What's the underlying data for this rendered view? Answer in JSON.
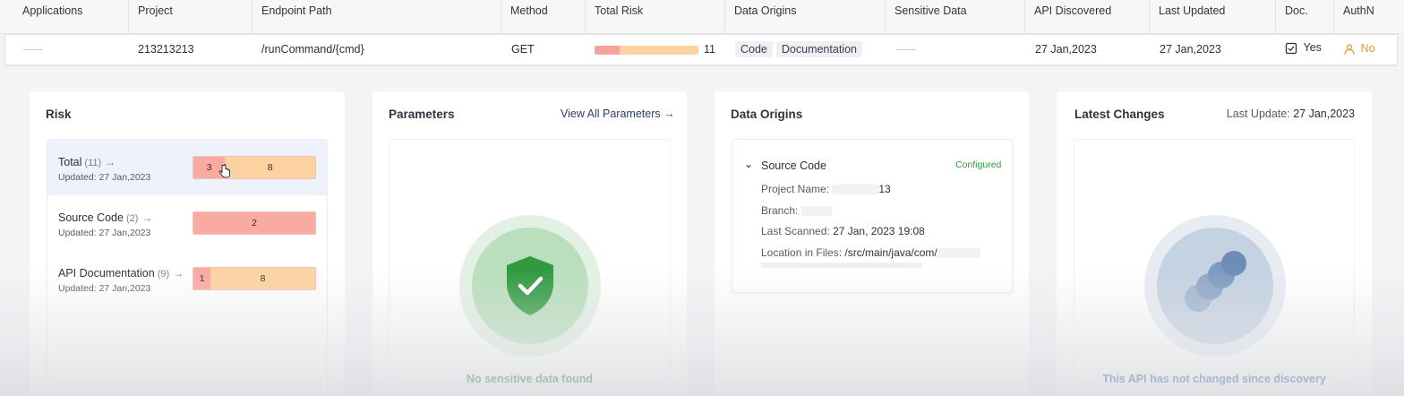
{
  "table": {
    "headers": [
      "Applications",
      "Project",
      "Endpoint Path",
      "Method",
      "Total Risk",
      "Data Origins",
      "Sensitive Data",
      "API Discovered",
      "Last Updated",
      "Doc.",
      "AuthN"
    ],
    "row": {
      "project": "213213213",
      "endpoint": "/runCommand/{cmd}",
      "method": "GET",
      "risk_total": "11",
      "risk_fraction_red": 0.24,
      "origins": [
        "Code",
        "Documentation"
      ],
      "discovered": "27 Jan,2023",
      "updated": "27 Jan,2023",
      "doc": "Yes",
      "authn": "No"
    }
  },
  "risk": {
    "title": "Risk",
    "items": [
      {
        "label": "Total",
        "count": "(11)",
        "updated": "Updated: 27 Jan,2023",
        "red": "3",
        "orange": "8"
      },
      {
        "label": "Source Code",
        "count": "(2)",
        "updated": "Updated: 27 Jan,2023",
        "red": "2",
        "orange": ""
      },
      {
        "label": "API Documentation",
        "count": "(9)",
        "updated": "Updated: 27 Jan,2023",
        "red": "1",
        "orange": "8"
      }
    ]
  },
  "parameters": {
    "title": "Parameters",
    "view_all": "View All Parameters →",
    "empty": "No sensitive data found"
  },
  "data_origins": {
    "title": "Data Origins",
    "source": "Source Code",
    "status": "Configured",
    "project_label": "Project Name:",
    "project_suffix": "13",
    "branch_label": "Branch:",
    "scanned_label": "Last Scanned:",
    "scanned_value": "27 Jan, 2023 19:08",
    "location_label": "Location in Files:",
    "location_value": "/src/main/java/com/"
  },
  "latest": {
    "title": "Latest Changes",
    "last_update_label": "Last Update:",
    "last_update_value": "27 Jan,2023",
    "empty": "This API has not changed since discovery"
  },
  "colors": {
    "risk_red": "#f9aaa1",
    "risk_orange": "#fcd3a0",
    "link_blue": "#3b86e0",
    "success_green": "#2f8f3a",
    "authn_orange": "#e39a2e",
    "info_blue": "#3c6aa8"
  }
}
